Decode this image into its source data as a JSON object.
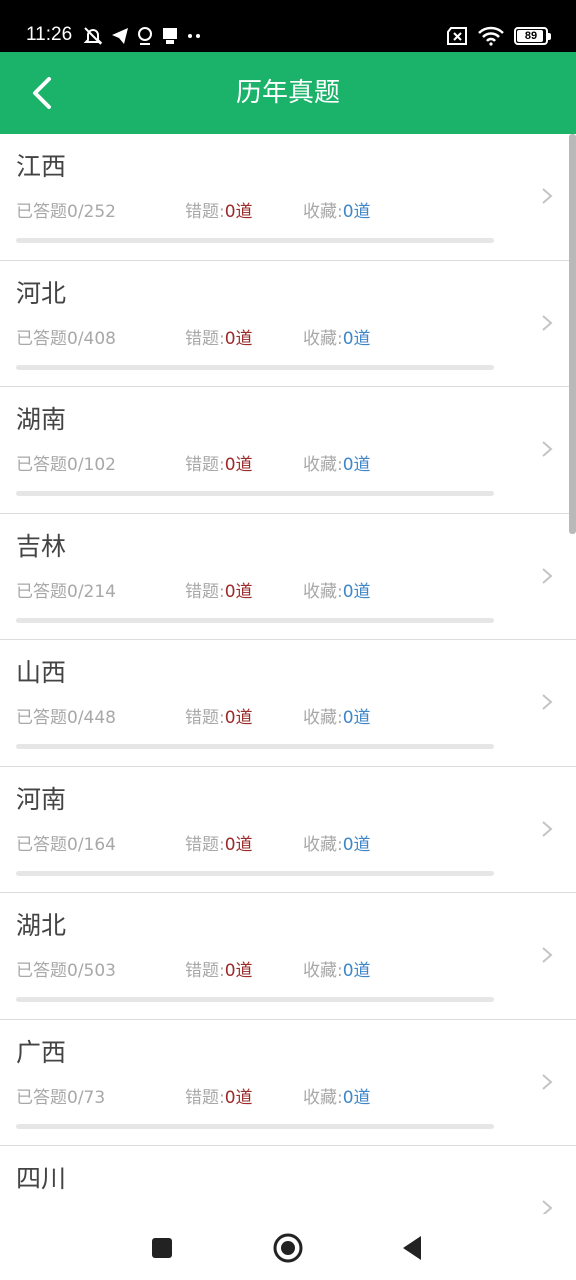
{
  "status_bar": {
    "time": "11:26",
    "battery_level": "89",
    "icons": [
      "mute-icon",
      "telegram-icon",
      "location-icon",
      "notification-icon",
      "more-dots-icon",
      "sim-none-icon",
      "wifi-icon",
      "battery-icon"
    ]
  },
  "app_bar": {
    "title": "历年真题",
    "back_icon": "chevron-left-icon",
    "color": "#1bb26a"
  },
  "colors": {
    "wrong_value": "#9b2a2a",
    "favorite_value": "#3f86c8"
  },
  "items": [
    {
      "name": "江西",
      "answered": "已答题0/252",
      "wrong_label": "错题:",
      "wrong_value": "0道",
      "fav_label": "收藏:",
      "fav_value": "0道",
      "progress": 0
    },
    {
      "name": "河北",
      "answered": "已答题0/408",
      "wrong_label": "错题:",
      "wrong_value": "0道",
      "fav_label": "收藏:",
      "fav_value": "0道",
      "progress": 0
    },
    {
      "name": "湖南",
      "answered": "已答题0/102",
      "wrong_label": "错题:",
      "wrong_value": "0道",
      "fav_label": "收藏:",
      "fav_value": "0道",
      "progress": 0
    },
    {
      "name": "吉林",
      "answered": "已答题0/214",
      "wrong_label": "错题:",
      "wrong_value": "0道",
      "fav_label": "收藏:",
      "fav_value": "0道",
      "progress": 0
    },
    {
      "name": "山西",
      "answered": "已答题0/448",
      "wrong_label": "错题:",
      "wrong_value": "0道",
      "fav_label": "收藏:",
      "fav_value": "0道",
      "progress": 0
    },
    {
      "name": "河南",
      "answered": "已答题0/164",
      "wrong_label": "错题:",
      "wrong_value": "0道",
      "fav_label": "收藏:",
      "fav_value": "0道",
      "progress": 0
    },
    {
      "name": "湖北",
      "answered": "已答题0/503",
      "wrong_label": "错题:",
      "wrong_value": "0道",
      "fav_label": "收藏:",
      "fav_value": "0道",
      "progress": 0
    },
    {
      "name": "广西",
      "answered": "已答题0/73",
      "wrong_label": "错题:",
      "wrong_value": "0道",
      "fav_label": "收藏:",
      "fav_value": "0道",
      "progress": 0
    },
    {
      "name": "四川"
    }
  ],
  "nav_bar": {
    "icons": [
      "recents-square-icon",
      "home-circle-icon",
      "back-triangle-icon"
    ]
  }
}
